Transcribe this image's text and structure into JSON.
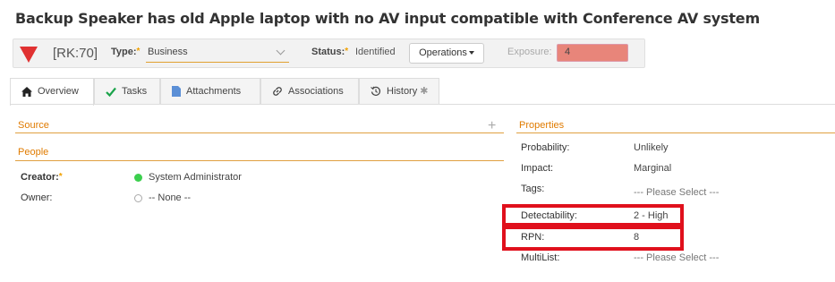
{
  "page": {
    "title": "Backup Speaker has old Apple laptop with no AV input compatible with Conference AV system"
  },
  "header": {
    "risk_id": "[RK:70]",
    "type_label": "Type:",
    "type_required": "*",
    "type_value": "Business",
    "status_label": "Status:",
    "status_required": "*",
    "status_value": "Identified",
    "operations_label": "Operations",
    "exposure_label": "Exposure:",
    "exposure_value": "4",
    "exposure_color": "#e8857a",
    "risk_color": "#e03131"
  },
  "tabs": [
    {
      "label": "Overview",
      "icon": "home-icon",
      "active": true
    },
    {
      "label": "Tasks",
      "icon": "check-icon"
    },
    {
      "label": "Attachments",
      "icon": "document-icon"
    },
    {
      "label": "Associations",
      "icon": "link-icon"
    },
    {
      "label": "History",
      "icon": "history-icon",
      "suffix": "✱"
    }
  ],
  "source": {
    "heading": "Source",
    "add_icon": "plus-icon"
  },
  "people": {
    "heading": "People",
    "creator_label": "Creator:",
    "creator_required": "*",
    "creator_value": "System Administrator",
    "owner_label": "Owner:",
    "owner_value": "-- None --"
  },
  "properties": {
    "heading": "Properties",
    "rows": [
      {
        "label": "Probability:",
        "value": "Unlikely"
      },
      {
        "label": "Impact:",
        "value": "Marginal"
      },
      {
        "label": "Tags:",
        "value": "--- Please Select ---"
      },
      {
        "label": "Detectability:",
        "value": "2 - High"
      },
      {
        "label": "RPN:",
        "value": "8"
      },
      {
        "label": "MultiList:",
        "value": "--- Please Select ---"
      }
    ]
  },
  "highlight_color": "#e0101c"
}
